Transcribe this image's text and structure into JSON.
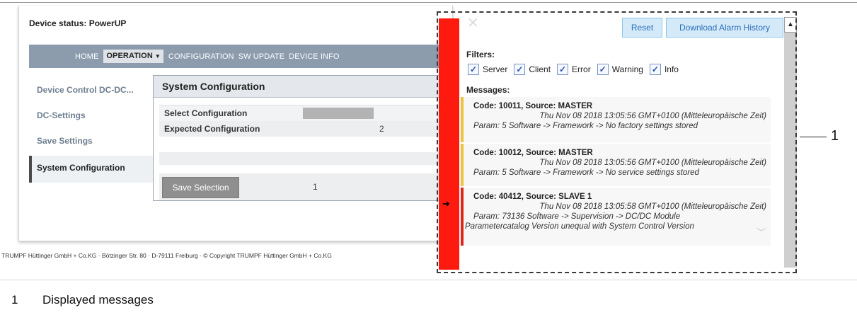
{
  "device_status": "Device status: PowerUP",
  "nav": {
    "home": "HOME",
    "operation": "OPERATION",
    "operation_arrow": "▼",
    "configuration": "CONFIGURATION",
    "sw_update": "SW UPDATE",
    "device_info": "DEVICE INFO"
  },
  "sidebar": {
    "items": [
      {
        "label": "Device Control DC-DC..."
      },
      {
        "label": "DC-Settings"
      },
      {
        "label": "Save Settings"
      },
      {
        "label": "System Configuration"
      }
    ]
  },
  "system_configuration": {
    "title": "System Configuration",
    "select_label": "Select Configuration",
    "expected_label": "Expected Configuration",
    "expected_value": "2",
    "save_button": "Save Selection",
    "save_value": "1"
  },
  "footer": "TRUMPF Hüttinger GmbH + Co.KG · Bötzinger Str. 80 · D-79111 Freiburg · © Copyright TRUMPF Hüttinger GmbH + Co.KG",
  "alarm_panel": {
    "close": "✕",
    "reset_button": "Reset",
    "download_button": "Download Alarm History",
    "filters_label": "Filters:",
    "filters": [
      {
        "label": "Server",
        "checked": true
      },
      {
        "label": "Client",
        "checked": true
      },
      {
        "label": "Error",
        "checked": true
      },
      {
        "label": "Warning",
        "checked": true
      },
      {
        "label": "Info",
        "checked": true
      }
    ],
    "messages_label": "Messages:",
    "messages": [
      {
        "code": "Code: 10011, Source: MASTER",
        "time": "Thu Nov 08 2018 13:05:56 GMT+0100 (Mitteleuropäische Zeit)",
        "param": "Param: 5 Software -> Framework -> No factory settings stored",
        "level_color": "#efc23e"
      },
      {
        "code": "Code: 10012, Source: MASTER",
        "time": "Thu Nov 08 2018 13:05:56 GMT+0100 (Mitteleuropäische Zeit)",
        "param": "Param: 5 Software -> Framework -> No service settings stored",
        "level_color": "#efc23e"
      },
      {
        "code": "Code: 40412, Source: SLAVE 1",
        "time": "Thu Nov 08 2018 13:05:58 GMT+0100 (Mitteleuropäische Zeit)",
        "param": "Param: 73136 Software -> Supervision -> DC/DC Module",
        "param_cont": "Parametercatalog Version unequal with System Control Version",
        "level_color": "#e0251b"
      }
    ]
  },
  "callout": {
    "number": "1",
    "legend_number": "1",
    "legend_text": "Displayed messages"
  },
  "colors": {
    "nav_bg": "#8d9cad",
    "red_strip": "#ff1a10",
    "warning": "#efc23e",
    "error": "#e0251b",
    "button_blue": "#d5eaf8"
  }
}
